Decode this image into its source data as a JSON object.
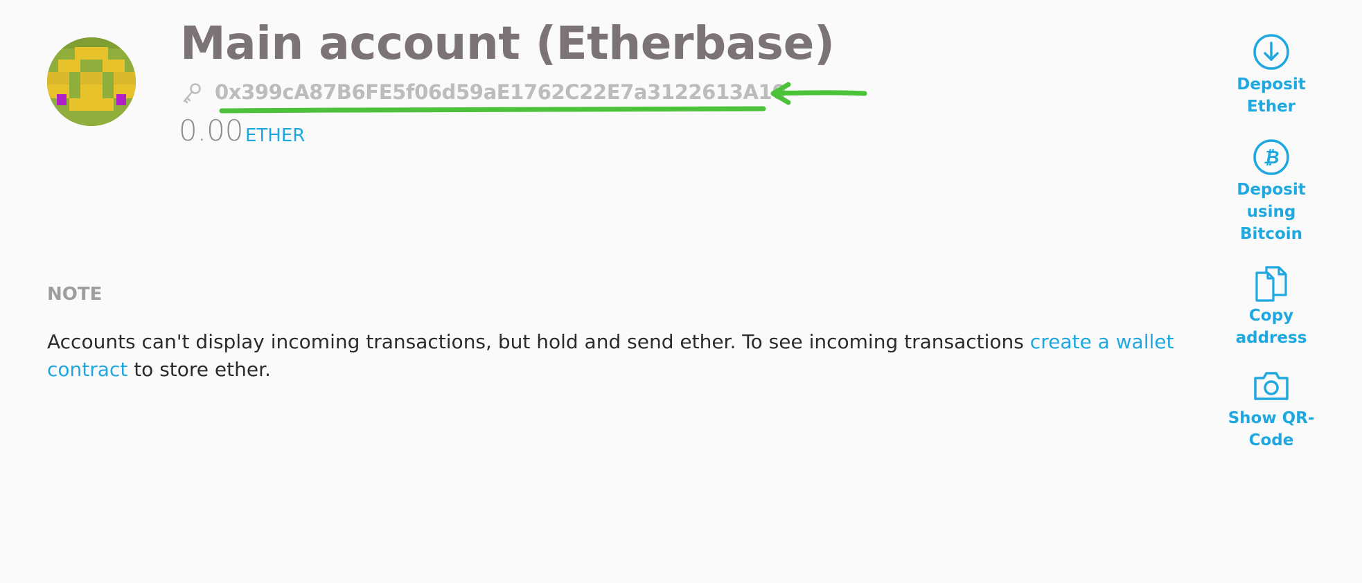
{
  "account": {
    "name": "Main account (Etherbase)",
    "address": "0x399cA87B6FE5f06d59aE1762C22E7a3122613A10",
    "balance": "0.00",
    "unit": "ETHER"
  },
  "note": {
    "heading": "NOTE",
    "text_before": "Accounts can't display incoming transactions, but hold and send ether. To see incoming transactions ",
    "link_text": "create a wallet contract",
    "text_after": " to store ether."
  },
  "actions": [
    {
      "label": "Deposit\nEther",
      "icon": "arrow-down-circle-icon"
    },
    {
      "label": "Deposit\nusing\nBitcoin",
      "icon": "bitcoin-icon"
    },
    {
      "label": "Copy\naddress",
      "icon": "copy-icon"
    },
    {
      "label": "Show QR-\nCode",
      "icon": "camera-icon"
    }
  ],
  "colors": {
    "accent": "#1fa8e0",
    "title": "#7c7474",
    "annotation": "#4cc23a",
    "background": "#fafafa"
  }
}
